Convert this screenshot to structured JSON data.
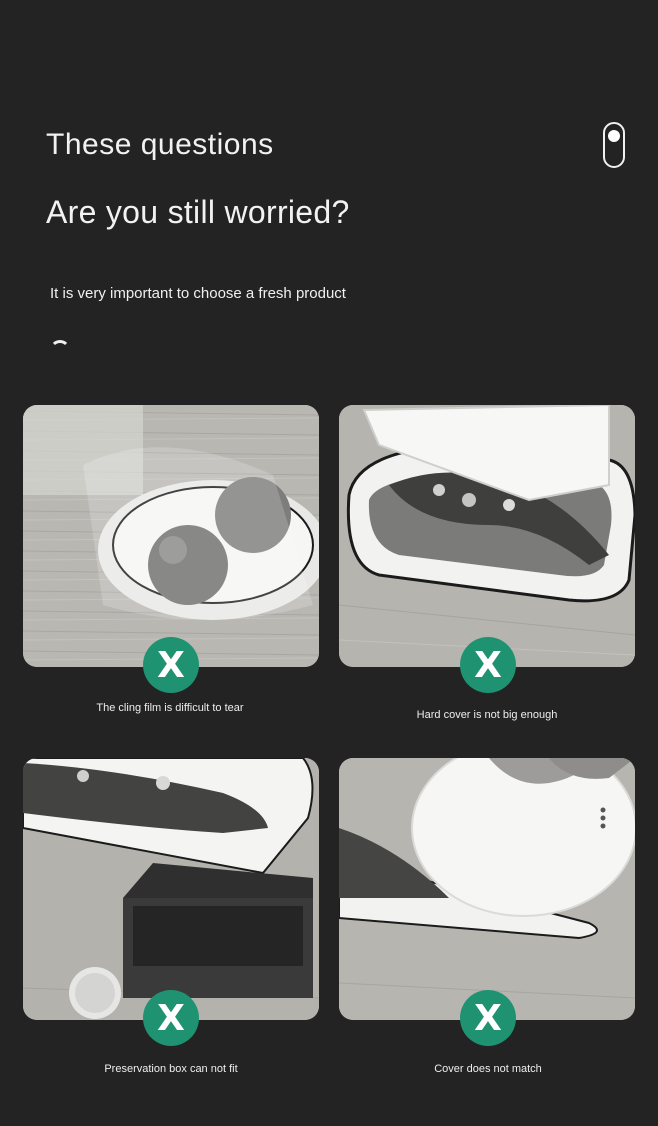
{
  "header": {
    "title_line1": "These questions",
    "title_line2": "Are you still worried?",
    "subtitle": "It is very important to choose a fresh product"
  },
  "icons": {
    "top_right": "toggle-switch-icon",
    "badge": "x-mark-icon",
    "badge_symbol": "X",
    "accent_color": "#1f9272"
  },
  "problems": [
    {
      "caption": "The cling film is difficult to tear",
      "image": "bowl-with-tomatoes-under-cling-film"
    },
    {
      "caption": "Hard cover is not big enough",
      "image": "fish-plate-with-small-hard-cover"
    },
    {
      "caption": "Preservation box can not fit",
      "image": "fish-plate-over-small-box"
    },
    {
      "caption": "Cover does not match",
      "image": "fish-plate-with-round-cover"
    }
  ]
}
